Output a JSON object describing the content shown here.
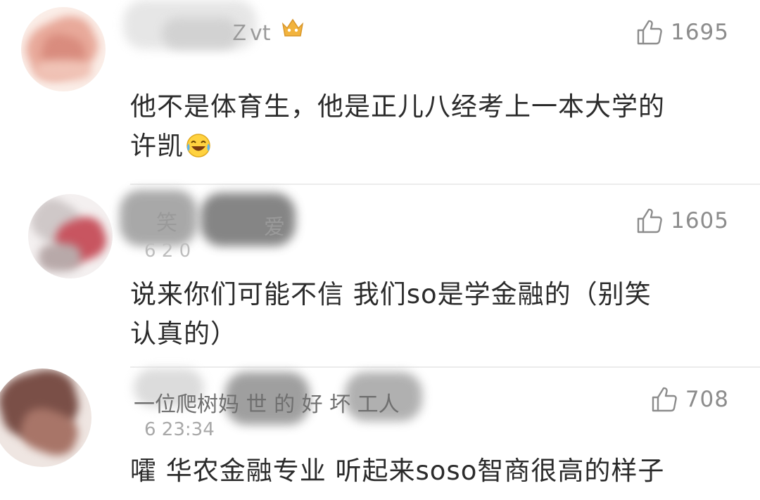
{
  "comments": [
    {
      "username_visible": "Ｚvt",
      "like_icon": "thumbs-up-outline-icon",
      "likes": "1695",
      "badge_icon": "crown-vip-icon",
      "text_line1": "他不是体育生，他是正儿八经考上一本大学的",
      "text_line2": "许凯",
      "emoji": "laugh-cry-emoji-icon"
    },
    {
      "username_visible_left": "笑",
      "username_visible_right": "爱",
      "timestamp_visible": "6 2 0",
      "like_icon": "thumbs-up-outline-icon",
      "likes": "1605",
      "text_line1": "说来你们可能不信  我们so是学金融的（别笑",
      "text_line2": "认真的）"
    },
    {
      "username_visible": "一位爬树妈   世 的 好   坏   工人",
      "timestamp_visible": "6 23:34",
      "like_icon": "thumbs-up-outline-icon",
      "likes": "708",
      "text_line1": "嚯  华农金融专业  听起来soso智商很高的样子"
    }
  ],
  "colors": {
    "text": "#2b2b2b",
    "meta": "#8c8c8c",
    "divider": "#ececec",
    "vip_badge": "#f2b33d"
  }
}
